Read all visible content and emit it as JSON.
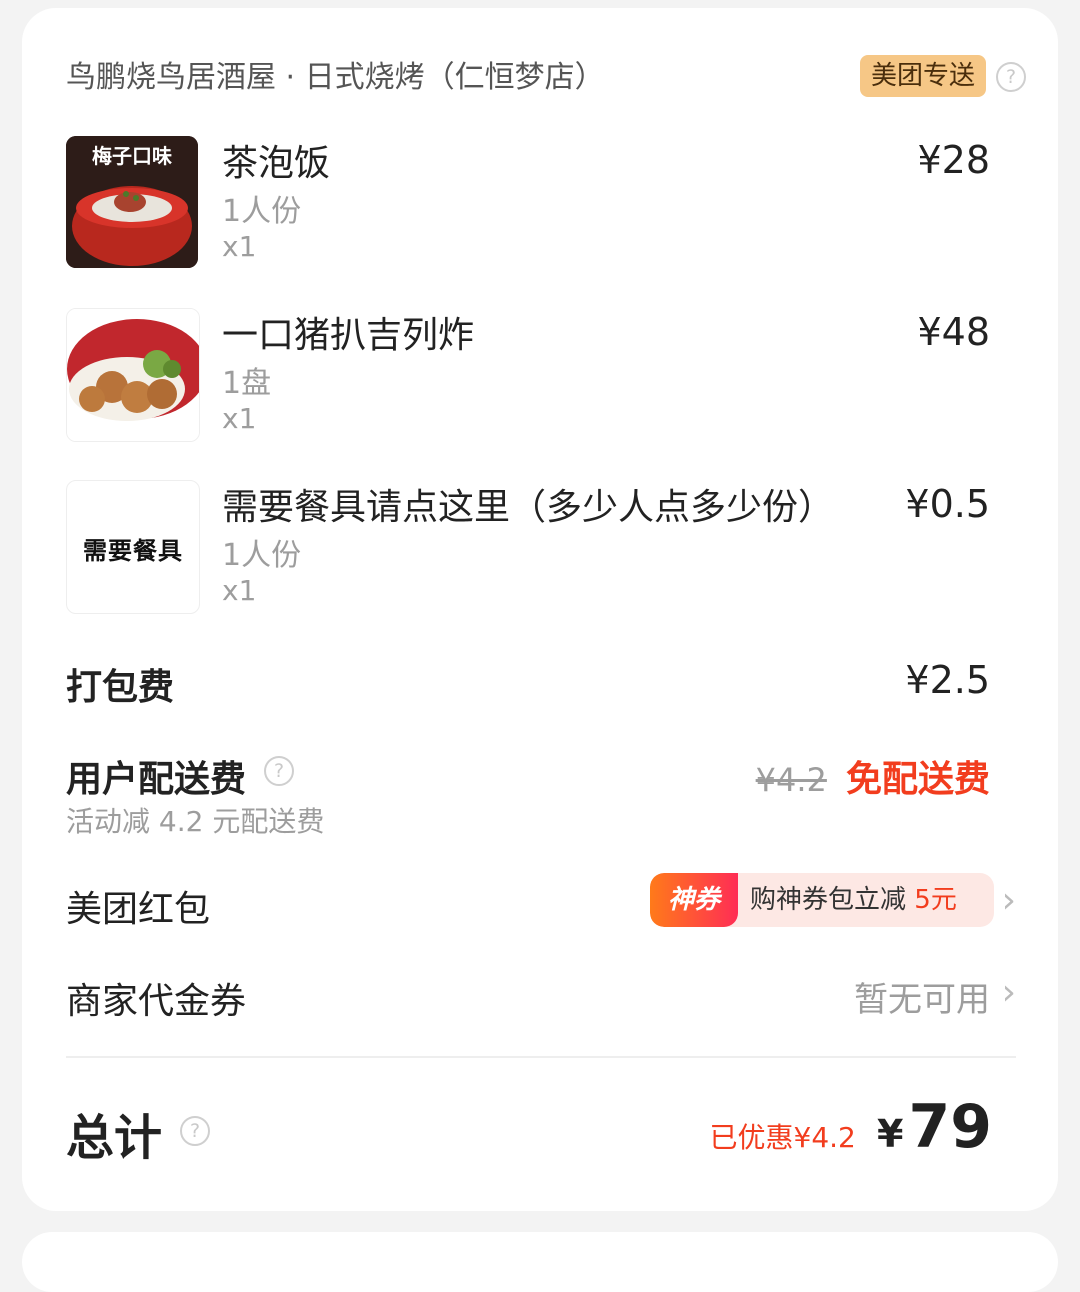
{
  "store": {
    "name": "鸟鹏烧鸟居酒屋 · 日式烧烤（仁恒梦店）",
    "delivery_tag": "美团专送"
  },
  "items": [
    {
      "name": "茶泡饭",
      "spec": "1人份",
      "qty": "x1",
      "price": "¥28",
      "thumb_text": "梅子口味"
    },
    {
      "name": "一口猪扒吉列炸",
      "spec": "1盘",
      "qty": "x1",
      "price": "¥48"
    },
    {
      "name": "需要餐具请点这里（多少人点多少份）",
      "spec": "1人份",
      "qty": "x1",
      "price": "¥0.5",
      "thumb_text": "需要餐具"
    }
  ],
  "packing": {
    "label": "打包费",
    "value": "¥2.5"
  },
  "delivery_fee": {
    "label": "用户配送费",
    "note": "活动减 4.2 元配送费",
    "original": "¥4.2",
    "free_label": "免配送费"
  },
  "red_packet": {
    "label": "美团红包",
    "badge": "神券",
    "promo_text": "购神券包立减",
    "promo_amount": "5元"
  },
  "merchant_coupon": {
    "label": "商家代金券",
    "value": "暂无可用"
  },
  "total": {
    "label": "总计",
    "discount": "已优惠¥4.2",
    "currency": "¥",
    "amount": "79"
  },
  "colors": {
    "accent_red": "#f23d1e",
    "tag_bg": "#f6c786"
  }
}
